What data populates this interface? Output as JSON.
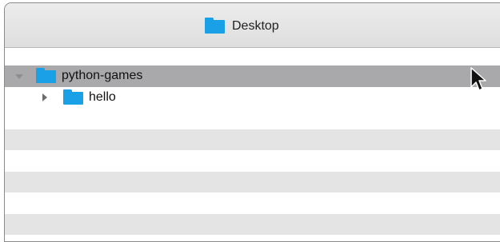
{
  "window": {
    "title": "Desktop",
    "title_icon": "folder-icon"
  },
  "tree": {
    "items": [
      {
        "label": "python-games",
        "icon": "folder-icon",
        "expanded": true,
        "selected": true,
        "level": 0
      },
      {
        "label": "hello",
        "icon": "folder-icon",
        "expanded": false,
        "selected": false,
        "level": 1
      }
    ]
  },
  "colors": {
    "folder": "#1aa0e6",
    "selection": "#a9a9ab",
    "stripe": "#e4e4e4"
  }
}
